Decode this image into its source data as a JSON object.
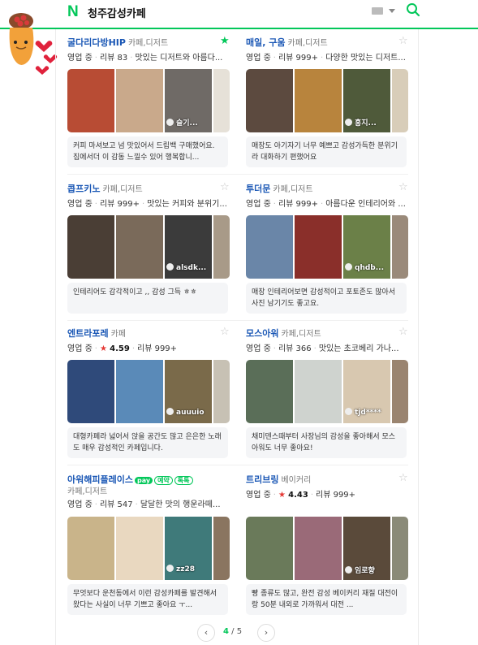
{
  "header": {
    "logo": "N",
    "query": "청주감성카페"
  },
  "pagination": {
    "prev": "‹",
    "next": "›",
    "current": "4",
    "separator": "/",
    "total": "5"
  },
  "places": [
    {
      "name": "굴다리다방HIP",
      "category": "카페,디저트",
      "status": "영업 중",
      "rating": "",
      "review_count": "리뷰 83",
      "snippet": "맛있는 디저트와 아름다...",
      "photo_user": "슬기...",
      "review": "커피 마셔보고 넘 맛있어서 드립백 구매했어요. 집에서더 이 감동 느낄수 있어 행복합니...",
      "bookmarked": true,
      "photo_colors": [
        "#b84c34",
        "#c9a98b",
        "#6f6a66",
        "#e6e1d8"
      ]
    },
    {
      "name": "매일, 구움",
      "category": "카페,디저트",
      "status": "영업 중",
      "rating": "",
      "review_count": "리뷰 999+",
      "snippet": "다양한 맛있는 디저트...",
      "photo_user": "홍지...",
      "review": "매장도 아기자기 너무 예쁘고 감성가득한 분위기라 대화하기 편했어요",
      "bookmarked": false,
      "photo_colors": [
        "#5c4a3f",
        "#b8843d",
        "#4f5a3a",
        "#d8cdb9"
      ]
    },
    {
      "name": "콥프키노",
      "category": "카페,디저트",
      "status": "영업 중",
      "rating": "",
      "review_count": "리뷰 999+",
      "snippet": "맛있는 커피와 분위기...",
      "photo_user": "alsdk...",
      "review": "인테리어도 감각적이고 ,, 감성 그득 ㅎㅎ",
      "bookmarked": false,
      "photo_colors": [
        "#4a3e35",
        "#7a6a5a",
        "#3b3b3b",
        "#a89a88"
      ]
    },
    {
      "name": "투더문",
      "category": "카페,디저트",
      "status": "영업 중",
      "rating": "",
      "review_count": "리뷰 999+",
      "snippet": "아름다운 인테리어와 ...",
      "photo_user": "qhdb...",
      "review": "매장 인테리어보면 감성적이고 포토존도 많아서 사진 남기기도 좋고요.",
      "bookmarked": false,
      "photo_colors": [
        "#6a86a8",
        "#8a2f2a",
        "#6b8048",
        "#9a8a7a"
      ]
    },
    {
      "name": "엔트라포레",
      "category": "카페",
      "status": "영업 중",
      "rating": "4.59",
      "review_count": "리뷰 999+",
      "snippet": "",
      "photo_user": "auuuio",
      "review": "대형카페라 넓어서 앉을 공간도 많고 은은한 노래도 매우 감성적인 카페입니다.",
      "bookmarked": false,
      "photo_colors": [
        "#2f4a7a",
        "#5a8ab8",
        "#7a6a4a",
        "#c7c1b4"
      ]
    },
    {
      "name": "모스아워",
      "category": "카페,디저트",
      "status": "영업 중",
      "rating": "",
      "review_count": "리뷰 366",
      "snippet": "맛있는 초코베리 가나...",
      "photo_user": "tjd****",
      "review": "채미덴스때부터 사장님의 감성을 좋아해서 모스아워도 너무 좋아요!",
      "bookmarked": false,
      "photo_colors": [
        "#5a6e58",
        "#cfd3cf",
        "#d8c8b0",
        "#9a8470"
      ]
    },
    {
      "name": "아워해피플레이스",
      "category": "카페,디저트",
      "status": "영업 중",
      "rating": "",
      "review_count": "리뷰 547",
      "snippet": "달달한 맛의 행운라떼...",
      "photo_user": "zz28",
      "review": "무엇보다 운천동에서 이런 감성카페를 발견해서 왔다는 사실이 너무 기쁘고 좋아요 ㅜ...",
      "bookmarked": false,
      "badge_pay": "pay",
      "badge_reserve": "예약",
      "badge_talk": "톡톡",
      "photo_colors": [
        "#c9b48a",
        "#e9d8c0",
        "#3f7a7a",
        "#8a7560"
      ]
    },
    {
      "name": "트리브링",
      "category": "베이커리",
      "status": "영업 중",
      "rating": "4.43",
      "review_count": "리뷰 999+",
      "snippet": "",
      "photo_user": "임로향",
      "review": "빵 종류도 많고, 완전 감성 베이커리 재질 대전이랑 50분 내외로 가까워서 대전 ...",
      "bookmarked": false,
      "photo_colors": [
        "#6a7a5a",
        "#9a6a78",
        "#5a4a3a",
        "#8a8a78"
      ]
    }
  ]
}
